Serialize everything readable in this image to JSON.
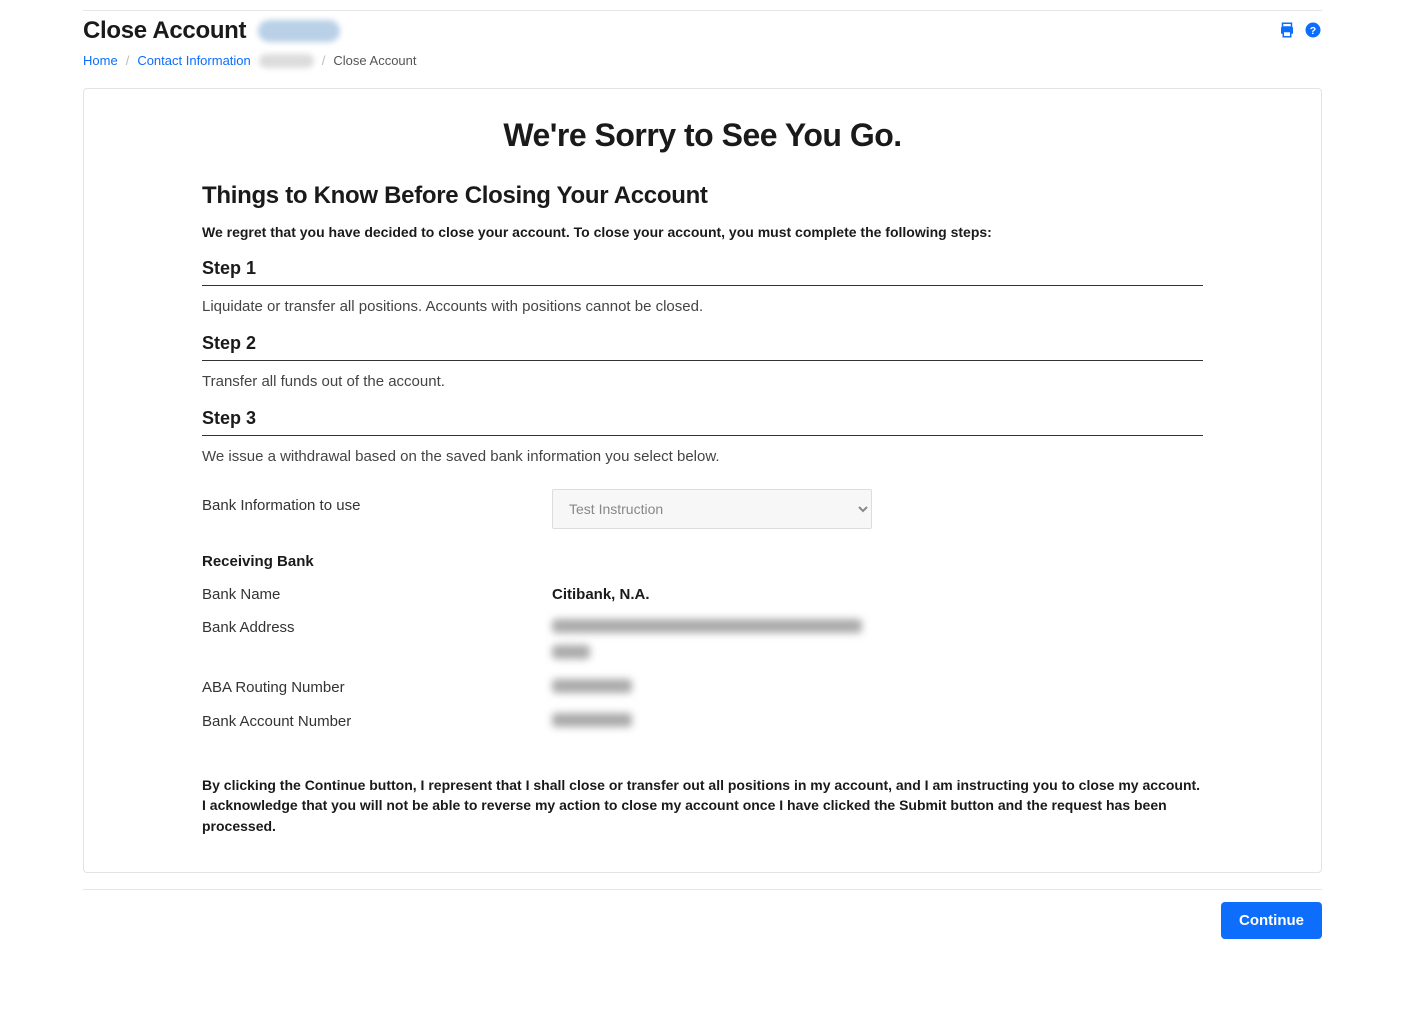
{
  "header": {
    "title": "Close Account"
  },
  "breadcrumb": {
    "home": "Home",
    "contact": "Contact Information",
    "current": "Close Account"
  },
  "main": {
    "hero": "We're Sorry to See You Go.",
    "subhead": "Things to Know Before Closing Your Account",
    "intro": "We regret that you have decided to close your account. To close your account, you must complete the following steps:",
    "step1_title": "Step 1",
    "step1_body": "Liquidate or transfer all positions. Accounts with positions cannot be closed.",
    "step2_title": "Step 2",
    "step2_body": "Transfer all funds out of the account.",
    "step3_title": "Step 3",
    "step3_body": "We issue a withdrawal based on the saved bank information you select below.",
    "bank_info_label": "Bank Information to use",
    "bank_select_option": "Test Instruction",
    "receiving_bank_label": "Receiving Bank",
    "rows": {
      "bank_name_label": "Bank Name",
      "bank_name_value": "Citibank, N.A.",
      "bank_address_label": "Bank Address",
      "aba_label": "ABA Routing Number",
      "acct_label": "Bank Account Number"
    },
    "disclaimer": "By clicking the Continue button, I represent that I shall close or transfer out all positions in my account, and I am instructing you to close my account. I acknowledge that you will not be able to reverse my action to close my account once I have clicked the Submit button and the request has been processed."
  },
  "footer": {
    "continue": "Continue"
  }
}
